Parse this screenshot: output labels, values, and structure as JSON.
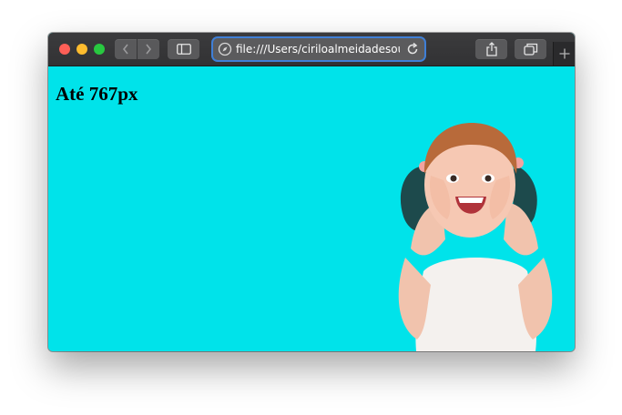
{
  "browser": {
    "url": "file:///Users/ciriloalmeidadesouza"
  },
  "page": {
    "heading": "Até 767px",
    "background_color": "#00e3ea"
  },
  "icons": {
    "back": "chevron-left-icon",
    "forward": "chevron-right-icon",
    "sidebar": "sidebar-icon",
    "compass": "compass-icon",
    "reload": "reload-icon",
    "share": "share-icon",
    "tabs": "tabs-icon",
    "new_tab": "plus-icon"
  }
}
